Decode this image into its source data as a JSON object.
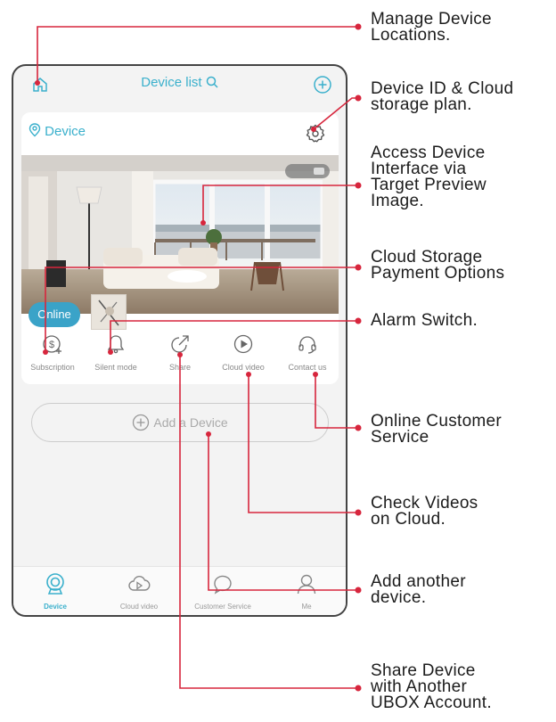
{
  "app": {
    "title": "Device list",
    "device_label": "Device",
    "online_badge": "Online",
    "toolbar": [
      {
        "label": "Subscription",
        "icon": "subscription-icon"
      },
      {
        "label": "Silent mode",
        "icon": "bell-icon"
      },
      {
        "label": "Share",
        "icon": "share-icon"
      },
      {
        "label": "Cloud video",
        "icon": "play-icon"
      },
      {
        "label": "Contact us",
        "icon": "headset-icon"
      }
    ],
    "add_device": "Add a Device",
    "tabs": [
      {
        "label": "Device",
        "icon": "camera-icon"
      },
      {
        "label": "Cloud video",
        "icon": "cloud-play-icon"
      },
      {
        "label": "Customer Service",
        "icon": "chat-icon"
      },
      {
        "label": "Me",
        "icon": "user-icon"
      }
    ]
  },
  "callouts": [
    {
      "lines": [
        "Manage Device",
        "Locations."
      ]
    },
    {
      "lines": [
        "Device ID & Cloud",
        "storage plan."
      ]
    },
    {
      "lines": [
        "Access Device",
        "Interface via",
        "Target Preview",
        "Image."
      ]
    },
    {
      "lines": [
        "Cloud Storage",
        "Payment Options"
      ]
    },
    {
      "lines": [
        "Alarm Switch."
      ]
    },
    {
      "lines": [
        "Online Customer",
        "Service"
      ]
    },
    {
      "lines": [
        "Check Videos",
        "on Cloud."
      ]
    },
    {
      "lines": [
        "Add another",
        "device."
      ]
    },
    {
      "lines": [
        "Share Device",
        "with Another",
        "UBOX Account."
      ]
    }
  ],
  "colors": {
    "accent": "#3ab0cc",
    "leader": "#d7263d"
  }
}
